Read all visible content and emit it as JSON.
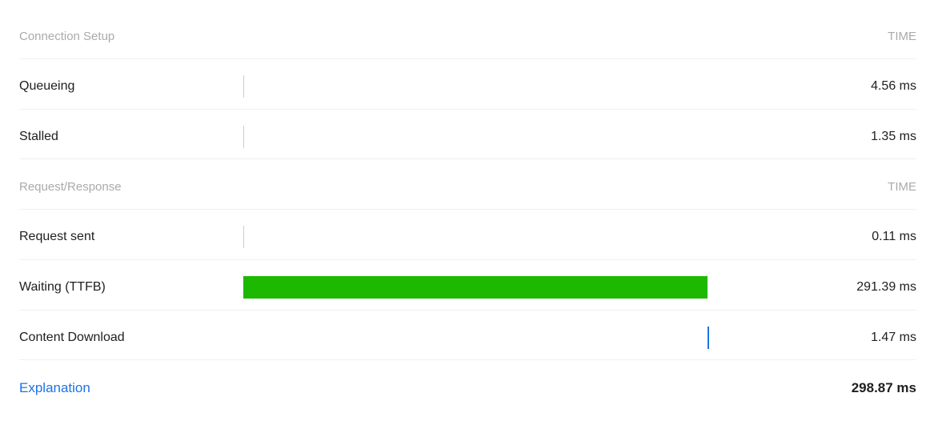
{
  "sections": {
    "connection_setup": {
      "label": "Connection Setup",
      "time_header": "TIME"
    },
    "request_response": {
      "label": "Request/Response",
      "time_header": "TIME"
    }
  },
  "rows": {
    "queueing": {
      "label": "Queueing",
      "time": "4.56 ms"
    },
    "stalled": {
      "label": "Stalled",
      "time": "1.35 ms"
    },
    "request_sent": {
      "label": "Request sent",
      "time": "0.11 ms"
    },
    "waiting_ttfb": {
      "label": "Waiting (TTFB)",
      "time": "291.39 ms"
    },
    "content_download": {
      "label": "Content Download",
      "time": "1.47 ms"
    }
  },
  "footer": {
    "explanation_label": "Explanation",
    "total_time": "298.87 ms"
  }
}
